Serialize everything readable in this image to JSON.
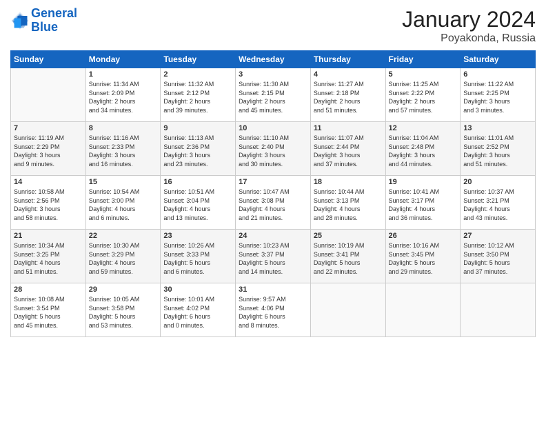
{
  "header": {
    "logo_line1": "General",
    "logo_line2": "Blue",
    "month": "January 2024",
    "location": "Poyakonda, Russia"
  },
  "weekdays": [
    "Sunday",
    "Monday",
    "Tuesday",
    "Wednesday",
    "Thursday",
    "Friday",
    "Saturday"
  ],
  "weeks": [
    [
      {
        "day": "",
        "info": ""
      },
      {
        "day": "1",
        "info": "Sunrise: 11:34 AM\nSunset: 2:09 PM\nDaylight: 2 hours\nand 34 minutes."
      },
      {
        "day": "2",
        "info": "Sunrise: 11:32 AM\nSunset: 2:12 PM\nDaylight: 2 hours\nand 39 minutes."
      },
      {
        "day": "3",
        "info": "Sunrise: 11:30 AM\nSunset: 2:15 PM\nDaylight: 2 hours\nand 45 minutes."
      },
      {
        "day": "4",
        "info": "Sunrise: 11:27 AM\nSunset: 2:18 PM\nDaylight: 2 hours\nand 51 minutes."
      },
      {
        "day": "5",
        "info": "Sunrise: 11:25 AM\nSunset: 2:22 PM\nDaylight: 2 hours\nand 57 minutes."
      },
      {
        "day": "6",
        "info": "Sunrise: 11:22 AM\nSunset: 2:25 PM\nDaylight: 3 hours\nand 3 minutes."
      }
    ],
    [
      {
        "day": "7",
        "info": "Sunrise: 11:19 AM\nSunset: 2:29 PM\nDaylight: 3 hours\nand 9 minutes."
      },
      {
        "day": "8",
        "info": "Sunrise: 11:16 AM\nSunset: 2:33 PM\nDaylight: 3 hours\nand 16 minutes."
      },
      {
        "day": "9",
        "info": "Sunrise: 11:13 AM\nSunset: 2:36 PM\nDaylight: 3 hours\nand 23 minutes."
      },
      {
        "day": "10",
        "info": "Sunrise: 11:10 AM\nSunset: 2:40 PM\nDaylight: 3 hours\nand 30 minutes."
      },
      {
        "day": "11",
        "info": "Sunrise: 11:07 AM\nSunset: 2:44 PM\nDaylight: 3 hours\nand 37 minutes."
      },
      {
        "day": "12",
        "info": "Sunrise: 11:04 AM\nSunset: 2:48 PM\nDaylight: 3 hours\nand 44 minutes."
      },
      {
        "day": "13",
        "info": "Sunrise: 11:01 AM\nSunset: 2:52 PM\nDaylight: 3 hours\nand 51 minutes."
      }
    ],
    [
      {
        "day": "14",
        "info": "Sunrise: 10:58 AM\nSunset: 2:56 PM\nDaylight: 3 hours\nand 58 minutes."
      },
      {
        "day": "15",
        "info": "Sunrise: 10:54 AM\nSunset: 3:00 PM\nDaylight: 4 hours\nand 6 minutes."
      },
      {
        "day": "16",
        "info": "Sunrise: 10:51 AM\nSunset: 3:04 PM\nDaylight: 4 hours\nand 13 minutes."
      },
      {
        "day": "17",
        "info": "Sunrise: 10:47 AM\nSunset: 3:08 PM\nDaylight: 4 hours\nand 21 minutes."
      },
      {
        "day": "18",
        "info": "Sunrise: 10:44 AM\nSunset: 3:13 PM\nDaylight: 4 hours\nand 28 minutes."
      },
      {
        "day": "19",
        "info": "Sunrise: 10:41 AM\nSunset: 3:17 PM\nDaylight: 4 hours\nand 36 minutes."
      },
      {
        "day": "20",
        "info": "Sunrise: 10:37 AM\nSunset: 3:21 PM\nDaylight: 4 hours\nand 43 minutes."
      }
    ],
    [
      {
        "day": "21",
        "info": "Sunrise: 10:34 AM\nSunset: 3:25 PM\nDaylight: 4 hours\nand 51 minutes."
      },
      {
        "day": "22",
        "info": "Sunrise: 10:30 AM\nSunset: 3:29 PM\nDaylight: 4 hours\nand 59 minutes."
      },
      {
        "day": "23",
        "info": "Sunrise: 10:26 AM\nSunset: 3:33 PM\nDaylight: 5 hours\nand 6 minutes."
      },
      {
        "day": "24",
        "info": "Sunrise: 10:23 AM\nSunset: 3:37 PM\nDaylight: 5 hours\nand 14 minutes."
      },
      {
        "day": "25",
        "info": "Sunrise: 10:19 AM\nSunset: 3:41 PM\nDaylight: 5 hours\nand 22 minutes."
      },
      {
        "day": "26",
        "info": "Sunrise: 10:16 AM\nSunset: 3:45 PM\nDaylight: 5 hours\nand 29 minutes."
      },
      {
        "day": "27",
        "info": "Sunrise: 10:12 AM\nSunset: 3:50 PM\nDaylight: 5 hours\nand 37 minutes."
      }
    ],
    [
      {
        "day": "28",
        "info": "Sunrise: 10:08 AM\nSunset: 3:54 PM\nDaylight: 5 hours\nand 45 minutes."
      },
      {
        "day": "29",
        "info": "Sunrise: 10:05 AM\nSunset: 3:58 PM\nDaylight: 5 hours\nand 53 minutes."
      },
      {
        "day": "30",
        "info": "Sunrise: 10:01 AM\nSunset: 4:02 PM\nDaylight: 6 hours\nand 0 minutes."
      },
      {
        "day": "31",
        "info": "Sunrise: 9:57 AM\nSunset: 4:06 PM\nDaylight: 6 hours\nand 8 minutes."
      },
      {
        "day": "",
        "info": ""
      },
      {
        "day": "",
        "info": ""
      },
      {
        "day": "",
        "info": ""
      }
    ]
  ]
}
